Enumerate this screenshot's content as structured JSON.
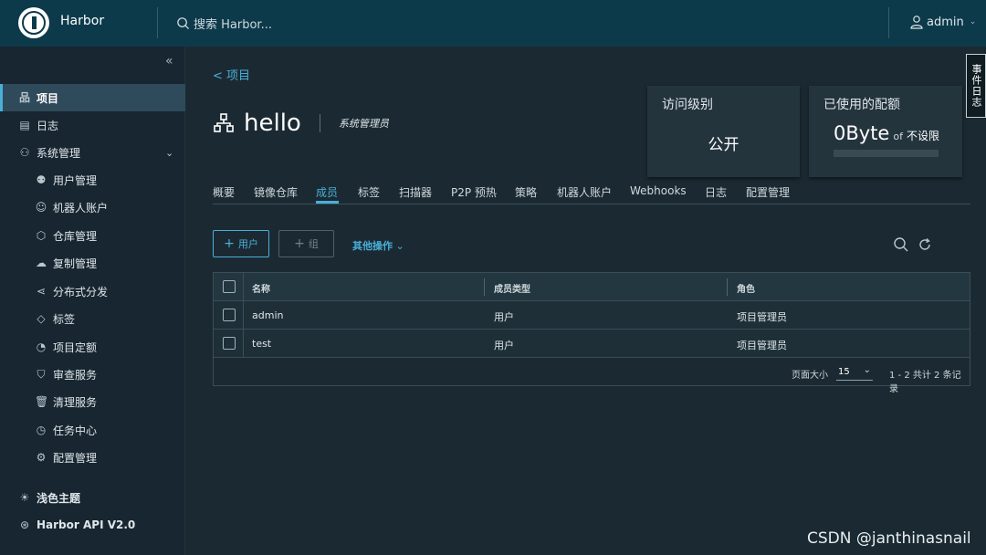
{
  "header": {
    "app_title": "Harbor",
    "search_placeholder": "搜索 Harbor...",
    "user": "admin"
  },
  "sidebar": {
    "items": [
      {
        "label": "项目",
        "icon": "project-icon"
      },
      {
        "label": "日志",
        "icon": "log-icon"
      },
      {
        "label": "系统管理",
        "icon": "admin-icon"
      },
      {
        "label": "用户管理",
        "icon": "users-icon"
      },
      {
        "label": "机器人账户",
        "icon": "robot-icon"
      },
      {
        "label": "仓库管理",
        "icon": "registry-icon"
      },
      {
        "label": "复制管理",
        "icon": "replication-icon"
      },
      {
        "label": "分布式分发",
        "icon": "share-icon"
      },
      {
        "label": "标签",
        "icon": "tag-icon"
      },
      {
        "label": "项目定额",
        "icon": "quota-icon"
      },
      {
        "label": "审查服务",
        "icon": "shield-icon"
      },
      {
        "label": "清理服务",
        "icon": "trash-icon"
      },
      {
        "label": "任务中心",
        "icon": "dashboard-icon"
      },
      {
        "label": "配置管理",
        "icon": "gear-icon"
      }
    ],
    "theme": "浅色主题",
    "api": "Harbor API V2.0"
  },
  "breadcrumb": "< 项目",
  "project": {
    "name": "hello",
    "role": "系统管理员"
  },
  "cards": {
    "access_label": "访问级别",
    "access_value": "公开",
    "quota_label": "已使用的配额",
    "quota_value": "0Byte",
    "quota_of": "of",
    "quota_limit": "不设限"
  },
  "event_tab": "事件日志",
  "tabs": [
    "概要",
    "镜像仓库",
    "成员",
    "标签",
    "扫描器",
    "P2P 预热",
    "策略",
    "机器人账户",
    "Webhooks",
    "日志",
    "配置管理"
  ],
  "active_tab": "成员",
  "actions": {
    "add_user": "用户",
    "add_group": "组",
    "more": "其他操作"
  },
  "table": {
    "columns": [
      "名称",
      "成员类型",
      "角色"
    ],
    "rows": [
      [
        "admin",
        "用户",
        "项目管理员"
      ],
      [
        "test",
        "用户",
        "项目管理员"
      ]
    ],
    "page_size_label": "页面大小",
    "page_size": "15",
    "summary": "1 - 2 共计 2 条记录"
  },
  "watermark": "CSDN @janthinasnail",
  "colors": {
    "accent": "#49afd9",
    "header": "#0c3a4b",
    "background": "#1b2a32"
  }
}
